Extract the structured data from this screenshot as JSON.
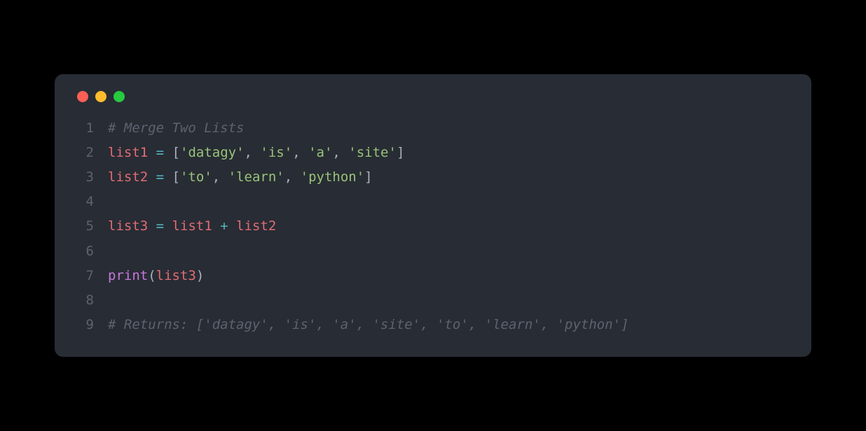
{
  "window": {
    "traffic_lights": [
      "red",
      "yellow",
      "green"
    ]
  },
  "code": {
    "lines": [
      {
        "num": "1",
        "tokens": [
          {
            "cls": "tok-comment",
            "text": "# Merge Two Lists"
          }
        ]
      },
      {
        "num": "2",
        "tokens": [
          {
            "cls": "tok-var",
            "text": "list1"
          },
          {
            "cls": "tok-plain",
            "text": " "
          },
          {
            "cls": "tok-op",
            "text": "="
          },
          {
            "cls": "tok-plain",
            "text": " "
          },
          {
            "cls": "tok-punct",
            "text": "["
          },
          {
            "cls": "tok-string",
            "text": "'datagy'"
          },
          {
            "cls": "tok-punct",
            "text": ", "
          },
          {
            "cls": "tok-string",
            "text": "'is'"
          },
          {
            "cls": "tok-punct",
            "text": ", "
          },
          {
            "cls": "tok-string",
            "text": "'a'"
          },
          {
            "cls": "tok-punct",
            "text": ", "
          },
          {
            "cls": "tok-string",
            "text": "'site'"
          },
          {
            "cls": "tok-punct",
            "text": "]"
          }
        ]
      },
      {
        "num": "3",
        "tokens": [
          {
            "cls": "tok-var",
            "text": "list2"
          },
          {
            "cls": "tok-plain",
            "text": " "
          },
          {
            "cls": "tok-op",
            "text": "="
          },
          {
            "cls": "tok-plain",
            "text": " "
          },
          {
            "cls": "tok-punct",
            "text": "["
          },
          {
            "cls": "tok-string",
            "text": "'to'"
          },
          {
            "cls": "tok-punct",
            "text": ", "
          },
          {
            "cls": "tok-string",
            "text": "'learn'"
          },
          {
            "cls": "tok-punct",
            "text": ", "
          },
          {
            "cls": "tok-string",
            "text": "'python'"
          },
          {
            "cls": "tok-punct",
            "text": "]"
          }
        ]
      },
      {
        "num": "4",
        "tokens": []
      },
      {
        "num": "5",
        "tokens": [
          {
            "cls": "tok-var",
            "text": "list3"
          },
          {
            "cls": "tok-plain",
            "text": " "
          },
          {
            "cls": "tok-op",
            "text": "="
          },
          {
            "cls": "tok-plain",
            "text": " "
          },
          {
            "cls": "tok-var",
            "text": "list1"
          },
          {
            "cls": "tok-plain",
            "text": " "
          },
          {
            "cls": "tok-op",
            "text": "+"
          },
          {
            "cls": "tok-plain",
            "text": " "
          },
          {
            "cls": "tok-var",
            "text": "list2"
          }
        ]
      },
      {
        "num": "6",
        "tokens": []
      },
      {
        "num": "7",
        "tokens": [
          {
            "cls": "tok-func",
            "text": "print"
          },
          {
            "cls": "tok-punct",
            "text": "("
          },
          {
            "cls": "tok-var",
            "text": "list3"
          },
          {
            "cls": "tok-punct",
            "text": ")"
          }
        ]
      },
      {
        "num": "8",
        "tokens": []
      },
      {
        "num": "9",
        "tokens": [
          {
            "cls": "tok-comment",
            "text": "# Returns: ['datagy', 'is', 'a', 'site', 'to', 'learn', 'python']"
          }
        ]
      }
    ]
  }
}
